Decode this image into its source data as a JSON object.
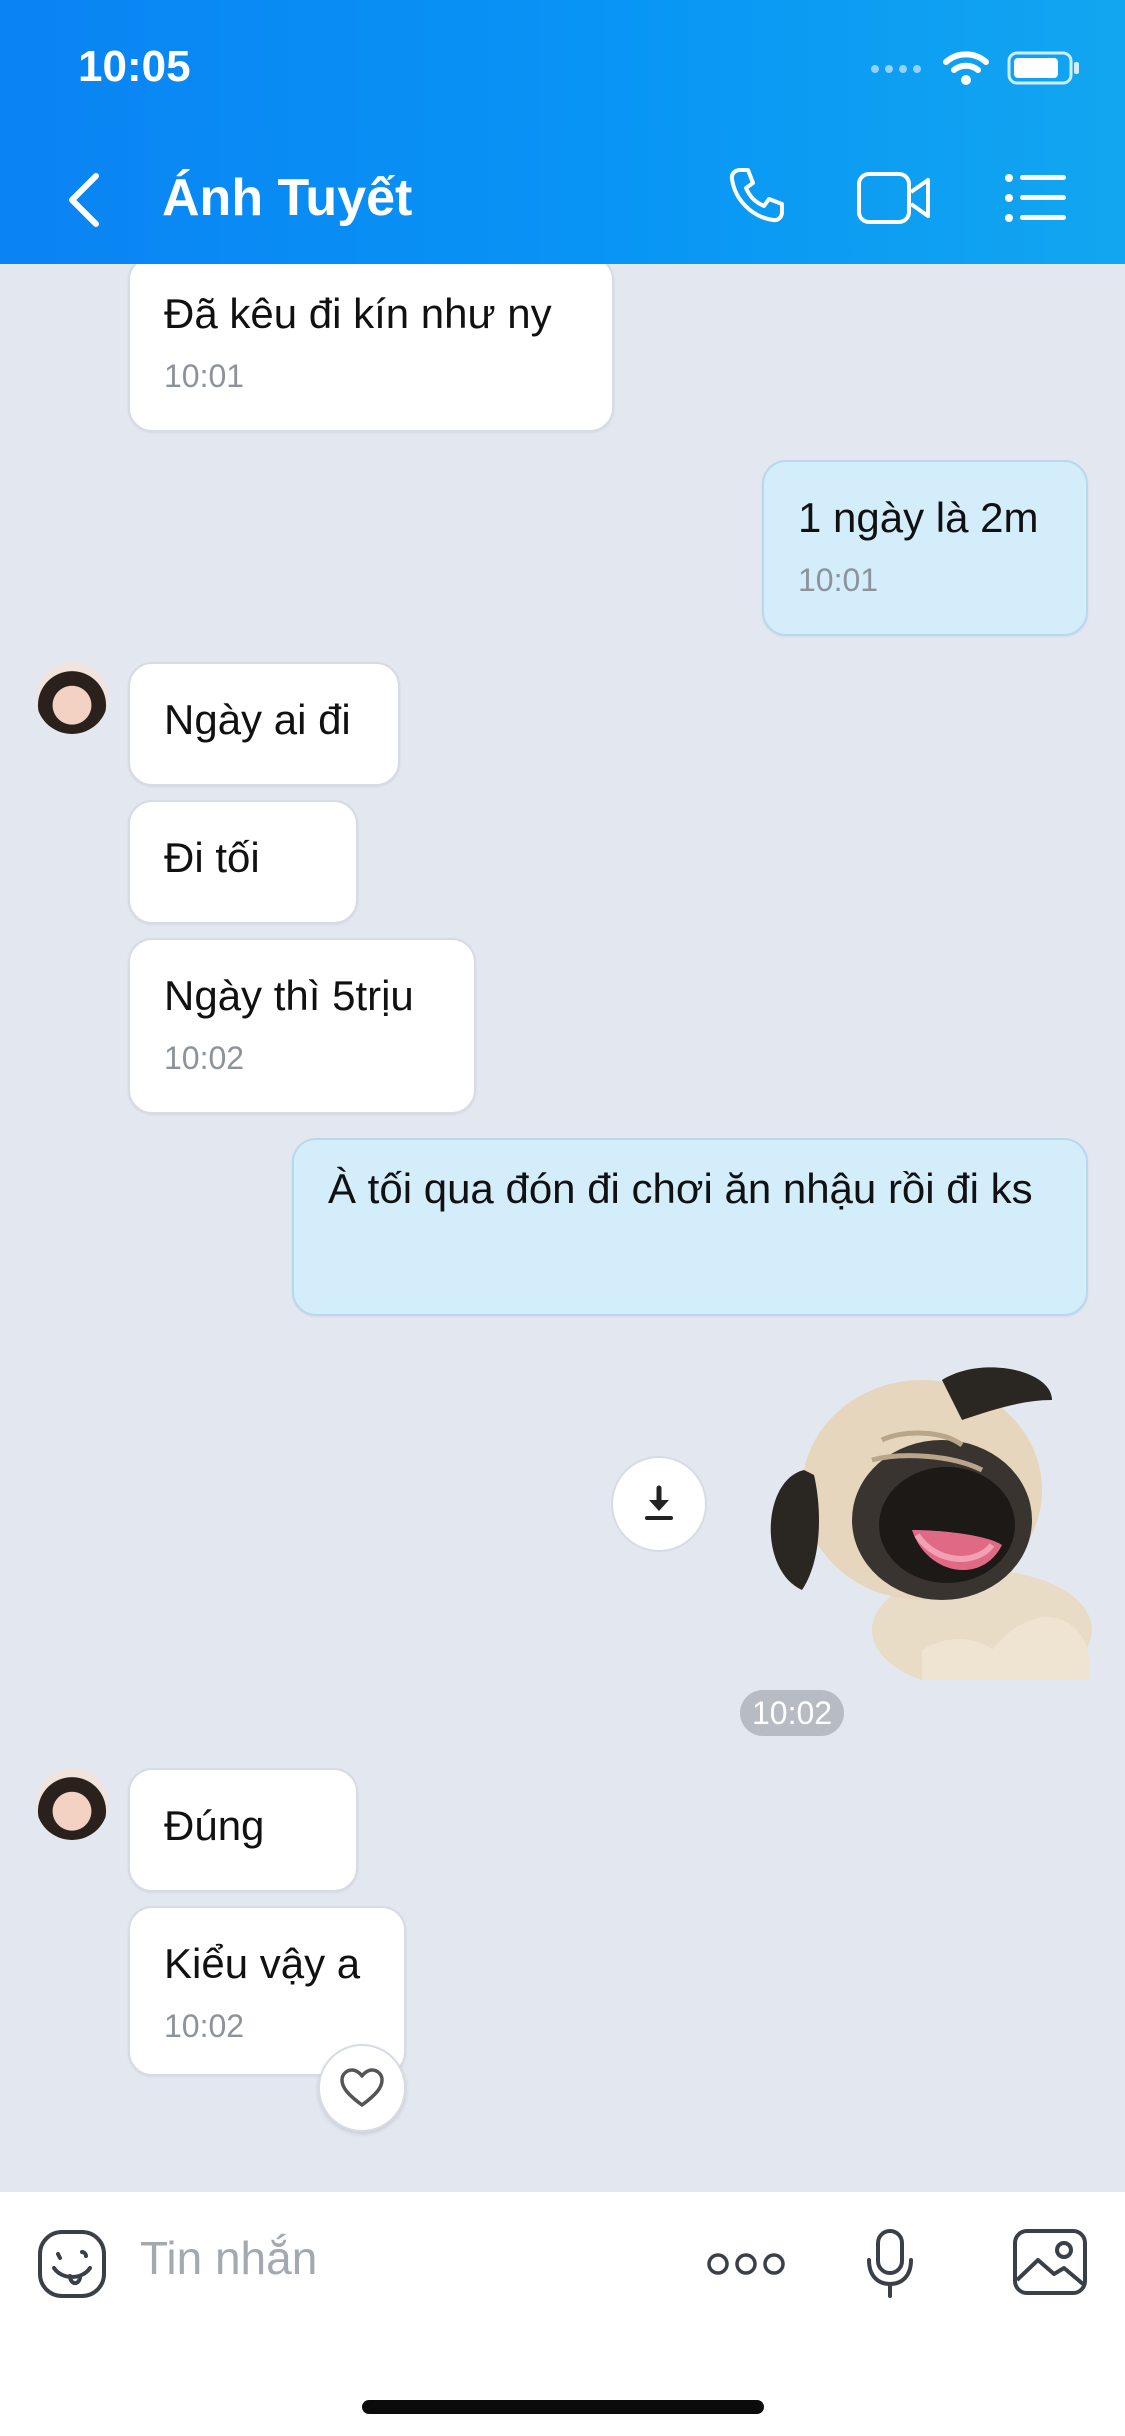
{
  "status_bar": {
    "time": "10:05"
  },
  "header": {
    "title": "Ánh Tuyết",
    "back_icon": "chevron-left-icon",
    "call_icon": "phone-icon",
    "video_icon": "video-camera-icon",
    "menu_icon": "list-menu-icon",
    "accent": "#0895f5"
  },
  "messages": [
    {
      "sender": "contact",
      "text": "Đã kêu đi kín như ny",
      "time": "10:01"
    },
    {
      "sender": "me",
      "text": "1 ngày là 2m",
      "time": "10:01"
    },
    {
      "sender": "contact",
      "text": "Ngày ai đi",
      "time": ""
    },
    {
      "sender": "contact",
      "text": "Đi tối",
      "time": ""
    },
    {
      "sender": "contact",
      "text": "Ngày thì 5trịu",
      "time": "10:02"
    },
    {
      "sender": "me",
      "text": "À tối qua đón đi chơi ăn nhậu rồi đi ks",
      "time": ""
    },
    {
      "sender": "me",
      "type": "sticker",
      "sticker": "laughing-pug-sticker",
      "time": "10:02"
    },
    {
      "sender": "contact",
      "text": "Đúng",
      "time": ""
    },
    {
      "sender": "contact",
      "text": "Kiểu vậy a",
      "time": "10:02"
    }
  ],
  "composer": {
    "placeholder": "Tin nhắn",
    "emoji_icon": "emoji-icon",
    "more_icon": "more-dots-icon",
    "mic_icon": "microphone-icon",
    "image_icon": "image-icon"
  },
  "colors": {
    "incoming_bubble": "#ffffff",
    "outgoing_bubble": "#d4edfb",
    "chat_background": "#e3e7ef"
  }
}
